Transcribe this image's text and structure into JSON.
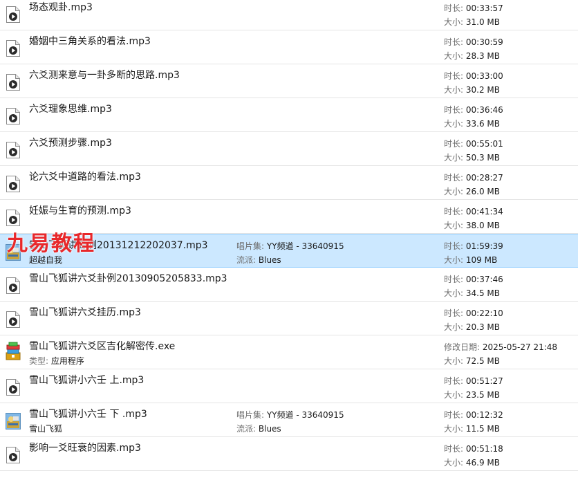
{
  "labels": {
    "duration": "时长:",
    "size": "大小:",
    "album": "唱片集:",
    "genre": "流派:",
    "type": "类型:",
    "modified": "修改日期:"
  },
  "watermark": "九易教程",
  "colors": {
    "selected_bg": "#cce8ff",
    "watermark": "#e8282b"
  },
  "files": [
    {
      "name": "场态观卦.mp3",
      "icon": "audio-file-icon",
      "duration": "00:33:57",
      "size": "31.0 MB"
    },
    {
      "name": "婚姻中三角关系的看法.mp3",
      "icon": "audio-file-icon",
      "duration": "00:30:59",
      "size": "28.3 MB"
    },
    {
      "name": "六爻测来意与一卦多断的思路.mp3",
      "icon": "audio-file-icon",
      "duration": "00:33:00",
      "size": "30.2 MB"
    },
    {
      "name": "六爻理象思维.mp3",
      "icon": "audio-file-icon",
      "duration": "00:36:46",
      "size": "33.6 MB"
    },
    {
      "name": "六爻预测步骤.mp3",
      "icon": "audio-file-icon",
      "duration": "00:55:01",
      "size": "50.3 MB"
    },
    {
      "name": "论六爻中道路的看法.mp3",
      "icon": "audio-file-icon",
      "duration": "00:28:27",
      "size": "26.0 MB"
    },
    {
      "name": "妊娠与生育的预测.mp3",
      "icon": "audio-file-icon",
      "duration": "00:41:34",
      "size": "38.0 MB"
    },
    {
      "name": "雪山飞狐讲卦例20131212202037.mp3",
      "icon": "album-art-icon",
      "artist": "超越自我",
      "album": "YY频道 - 33640915",
      "genre": "Blues",
      "duration": "01:59:39",
      "size": "109 MB",
      "selected": true
    },
    {
      "name": "雪山飞狐讲六爻卦例20130905205833.mp3",
      "icon": "audio-file-icon",
      "duration": "00:37:46",
      "size": "34.5 MB"
    },
    {
      "name": "雪山飞狐讲六爻挂历.mp3",
      "icon": "audio-file-icon",
      "duration": "00:22:10",
      "size": "20.3 MB"
    },
    {
      "name": "雪山飞狐讲六爻区吉化解密传.exe",
      "icon": "application-icon",
      "type": "应用程序",
      "modified": "2025-05-27 21:48",
      "size": "72.5 MB"
    },
    {
      "name": "雪山飞狐讲小六壬 上.mp3",
      "icon": "audio-file-icon",
      "duration": "00:51:27",
      "size": "23.5 MB"
    },
    {
      "name": "雪山飞狐讲小六壬 下 .mp3",
      "icon": "album-art-icon",
      "artist": "雪山飞狐",
      "album": "YY频道 - 33640915",
      "genre": "Blues",
      "duration": "00:12:32",
      "size": "11.5 MB"
    },
    {
      "name": "影响一爻旺衰的因素.mp3",
      "icon": "audio-file-icon",
      "duration": "00:51:18",
      "size": "46.9 MB"
    }
  ]
}
